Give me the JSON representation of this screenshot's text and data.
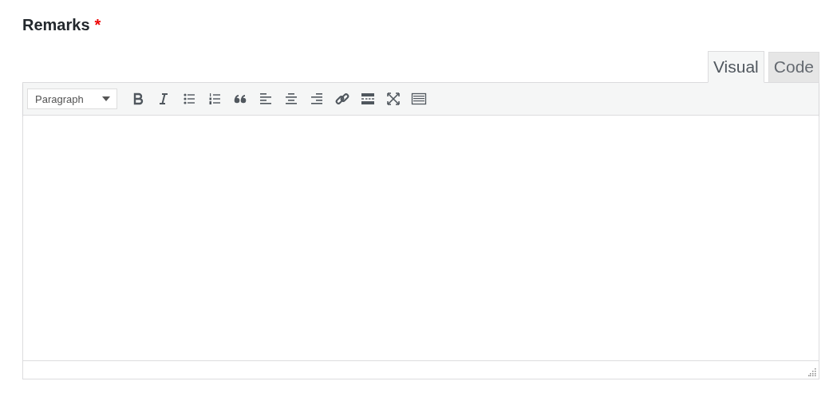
{
  "field": {
    "label": "Remarks",
    "required_mark": "*"
  },
  "tabs": [
    {
      "label": "Visual",
      "selected": true
    },
    {
      "label": "Code",
      "selected": false
    }
  ],
  "format_select": {
    "value": "Paragraph"
  },
  "toolbar": [
    {
      "kind": "bold"
    },
    {
      "kind": "italic"
    },
    {
      "kind": "bullets"
    },
    {
      "kind": "numbers"
    },
    {
      "kind": "quote"
    },
    {
      "kind": "align-left"
    },
    {
      "kind": "align-center"
    },
    {
      "kind": "align-right"
    },
    {
      "kind": "link"
    },
    {
      "kind": "more"
    },
    {
      "kind": "fullscreen"
    },
    {
      "kind": "toolbar-toggle"
    }
  ]
}
